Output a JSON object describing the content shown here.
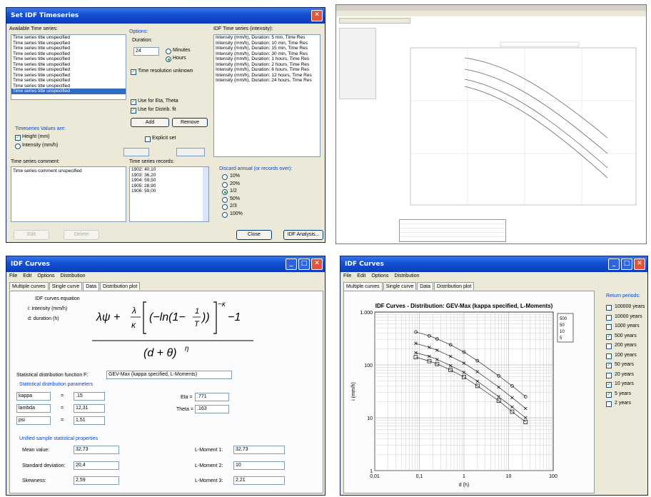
{
  "w1": {
    "title": "Set IDF Timeseries",
    "avail_label": "Available Time series:",
    "avail_items": [
      "Time series title unspecified",
      "Time series title unspecified",
      "Time series title unspecified",
      "Time series title unspecified",
      "Time series title unspecified",
      "Time series title unspecified",
      "Time series title unspecified",
      "Time series title unspecified",
      "Time series title unspecified",
      "Time series title unspecified",
      "Time series title unspecified"
    ],
    "options_label": "Options:",
    "duration_label": "Duration:",
    "duration_value": "24",
    "minutes": "Minutes",
    "hours": "Hours",
    "tr_unknown": "Time resolution unknown",
    "use_eta": "Use for Eta, Theta",
    "use_dist": "Use for Distrib. fit",
    "add": "Add",
    "remove": "Remove",
    "explicit": "Explicit set",
    "idf_label": "IDF Time series (intensity):",
    "idf_items": [
      "Intensity (mm/h), Duration: 5 min, Time Res",
      "Intensity (mm/h), Duration: 10 min, Time Res",
      "Intensity (mm/h), Duration: 15 min, Time Res",
      "Intensity (mm/h), Duration: 30 min, Time Res",
      "Intensity (mm/h), Duration: 1 hours, Time Res",
      "Intensity (mm/h), Duration: 2 hours, Time Res",
      "Intensity (mm/h), Duration: 6 hours, Time Res",
      "Intensity (mm/h), Duration: 12 hours, Time Res",
      "Intensity (mm/h), Duration: 24 hours, Time Res"
    ],
    "dim_label": "Timeseries Values are:",
    "height": "Height (mm)",
    "intensity": "Intensity (mm/h)",
    "comment_label": "Time series comment:",
    "comment_value": "Time series comment unspecified",
    "records_label": "Time series records:",
    "records": [
      "1902: 40,10",
      "1903: 36,20",
      "1904: 59,50",
      "1905: 28,90",
      "1906: 59,00"
    ],
    "excl_label": "Discard annual (or records over):",
    "excl_opts": [
      "10%",
      "20%",
      "1/2",
      "50%",
      "2/3",
      "100%"
    ],
    "close": "Close",
    "idf_analysis": "IDF Analysis...",
    "edit": "Edit",
    "delete": "Delete"
  },
  "w3": {
    "title": "IDF Curves",
    "menu": [
      "File",
      "Edit",
      "Options",
      "Distribution"
    ],
    "tabs": [
      "Multiple curves",
      "Single curve",
      "Data",
      "Distribution plot"
    ],
    "eq_title": "IDF curves equation",
    "eq_i": "i: intensity (mm/h)",
    "eq_d": "d: duration (h)",
    "dist_label": "Statistical distribution function F:",
    "dist_value": "GEV-Max (kappa specified, L-Moments)",
    "params_label": "Statistical distribution parameters",
    "params": [
      {
        "name": "kappa",
        "value": ".15"
      },
      {
        "name": "lambda",
        "value": "12,31"
      },
      {
        "name": "psi",
        "value": "1,51"
      }
    ],
    "eta_label": "Eta =",
    "eta_value": ".771",
    "theta_label": "Theta =",
    "theta_value": ".163",
    "unified_label": "Unified sample statistical properties",
    "mean_label": "Mean value:",
    "mean_value": "32,73",
    "std_label": "Standard deviation:",
    "std_value": "20,4",
    "skew_label": "Skewness:",
    "skew_value": "2,59",
    "lm1_label": "L-Moment 1:",
    "lm1_value": "32,73",
    "lm2_label": "L-Moment 2:",
    "lm2_value": "10",
    "lm3_label": "L-Moment 3:",
    "lm3_value": "2,21"
  },
  "w4": {
    "title": "IDF Curves",
    "menu": [
      "File",
      "Edit",
      "Options",
      "Distribution"
    ],
    "tabs": [
      "Multiple curves",
      "Single curve",
      "Data",
      "Distribution plot"
    ],
    "rp_label": "Return periods:",
    "rp": [
      {
        "label": "100000 years",
        "checked": false
      },
      {
        "label": "10000 years",
        "checked": false
      },
      {
        "label": "1000 years",
        "checked": false
      },
      {
        "label": "500 years",
        "checked": true
      },
      {
        "label": "200 years",
        "checked": false
      },
      {
        "label": "100 years",
        "checked": false
      },
      {
        "label": "50 years",
        "checked": true
      },
      {
        "label": "20 years",
        "checked": false
      },
      {
        "label": "10 years",
        "checked": true
      },
      {
        "label": "5 years",
        "checked": true
      },
      {
        "label": "2 years",
        "checked": false
      }
    ],
    "legend": [
      "500",
      "50",
      "10",
      "5"
    ]
  },
  "chart_data": {
    "type": "line",
    "title": "IDF Curves - Distribution: GEV-Max (kappa specified, L-Moments)",
    "xlabel": "d (h)",
    "ylabel": "i (mm/h)",
    "xscale": "log",
    "yscale": "log",
    "xlim": [
      0.01,
      100
    ],
    "ylim": [
      1,
      1000
    ],
    "xticks": [
      "0,01",
      "0,1",
      "1",
      "10",
      "100"
    ],
    "yticks": [
      "1",
      "10",
      "100",
      "1.000"
    ],
    "x": [
      0.083,
      0.167,
      0.25,
      0.5,
      1,
      2,
      6,
      12,
      24
    ],
    "series": [
      {
        "name": "500",
        "values": [
          420,
          355,
          310,
          240,
          175,
          120,
          62,
          40,
          25
        ]
      },
      {
        "name": "50",
        "values": [
          255,
          215,
          190,
          145,
          108,
          74,
          38,
          24,
          15
        ]
      },
      {
        "name": "10",
        "values": [
          170,
          145,
          127,
          97,
          72,
          49,
          25,
          16,
          10
        ]
      },
      {
        "name": "5",
        "values": [
          140,
          118,
          104,
          80,
          59,
          40,
          21,
          13,
          8.3
        ]
      }
    ],
    "legend_position": "top-right",
    "grid": true
  }
}
